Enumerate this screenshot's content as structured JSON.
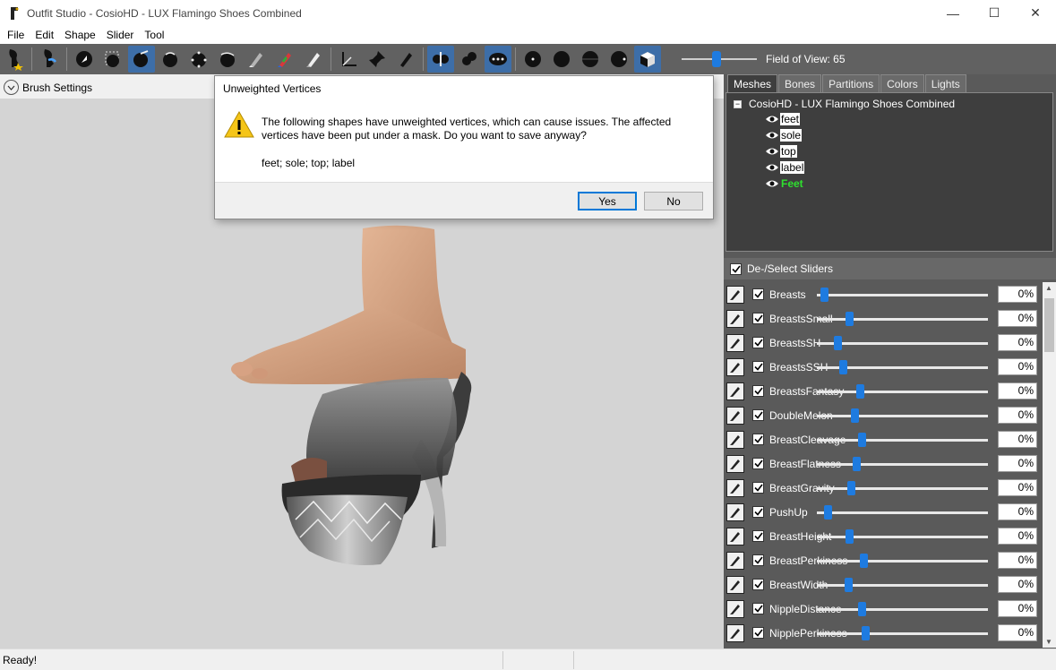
{
  "window": {
    "title": "Outfit Studio - CosioHD - LUX Flamingo Shoes Combined",
    "minimize": "—",
    "maximize": "☐",
    "close": "✕"
  },
  "menu": [
    "File",
    "Edit",
    "Shape",
    "Slider",
    "Tool"
  ],
  "toolbar": {
    "fov_label": "Field of View: 65",
    "fov_value": 65
  },
  "brush_settings": {
    "label": "Brush Settings"
  },
  "tabs": [
    {
      "label": "Meshes",
      "active": true
    },
    {
      "label": "Bones",
      "active": false
    },
    {
      "label": "Partitions",
      "active": false
    },
    {
      "label": "Colors",
      "active": false
    },
    {
      "label": "Lights",
      "active": false
    }
  ],
  "mesh_tree": {
    "root": "CosioHD - LUX Flamingo Shoes Combined",
    "children": [
      {
        "label": "feet",
        "highlight": false
      },
      {
        "label": "sole",
        "highlight": false
      },
      {
        "label": "top",
        "highlight": false
      },
      {
        "label": "label",
        "highlight": false
      },
      {
        "label": "Feet",
        "highlight": true
      }
    ]
  },
  "sliders_header": {
    "label": "De-/Select Sliders"
  },
  "sliders": [
    {
      "name": "Breasts",
      "value": "0%",
      "pos": 0.02
    },
    {
      "name": "BreastsSmall",
      "value": "0%",
      "pos": 0.17
    },
    {
      "name": "BreastsSH",
      "value": "0%",
      "pos": 0.1
    },
    {
      "name": "BreastsSSH",
      "value": "0%",
      "pos": 0.13
    },
    {
      "name": "BreastsFantasy",
      "value": "0%",
      "pos": 0.23
    },
    {
      "name": "DoubleMelon",
      "value": "0%",
      "pos": 0.2
    },
    {
      "name": "BreastCleavage",
      "value": "0%",
      "pos": 0.24
    },
    {
      "name": "BreastFlatness",
      "value": "0%",
      "pos": 0.21
    },
    {
      "name": "BreastGravity",
      "value": "0%",
      "pos": 0.18
    },
    {
      "name": "PushUp",
      "value": "0%",
      "pos": 0.04
    },
    {
      "name": "BreastHeight",
      "value": "0%",
      "pos": 0.17
    },
    {
      "name": "BreastPerkiness",
      "value": "0%",
      "pos": 0.25
    },
    {
      "name": "BreastWidth",
      "value": "0%",
      "pos": 0.16
    },
    {
      "name": "NippleDistance",
      "value": "0%",
      "pos": 0.24
    },
    {
      "name": "NipplePerkiness",
      "value": "0%",
      "pos": 0.26
    }
  ],
  "status": {
    "text": "Ready!"
  },
  "dialog": {
    "title": "Unweighted Vertices",
    "message": "The following shapes have unweighted vertices, which can cause issues. The affected vertices have been put under a mask. Do you want to save anyway?",
    "list": "feet; sole; top; label",
    "yes": "Yes",
    "no": "No"
  },
  "colors": {
    "accent": "#1e7be0",
    "toolbar": "#616161",
    "panel": "#5a5a5a",
    "highlight_mesh": "#2fe02f"
  }
}
